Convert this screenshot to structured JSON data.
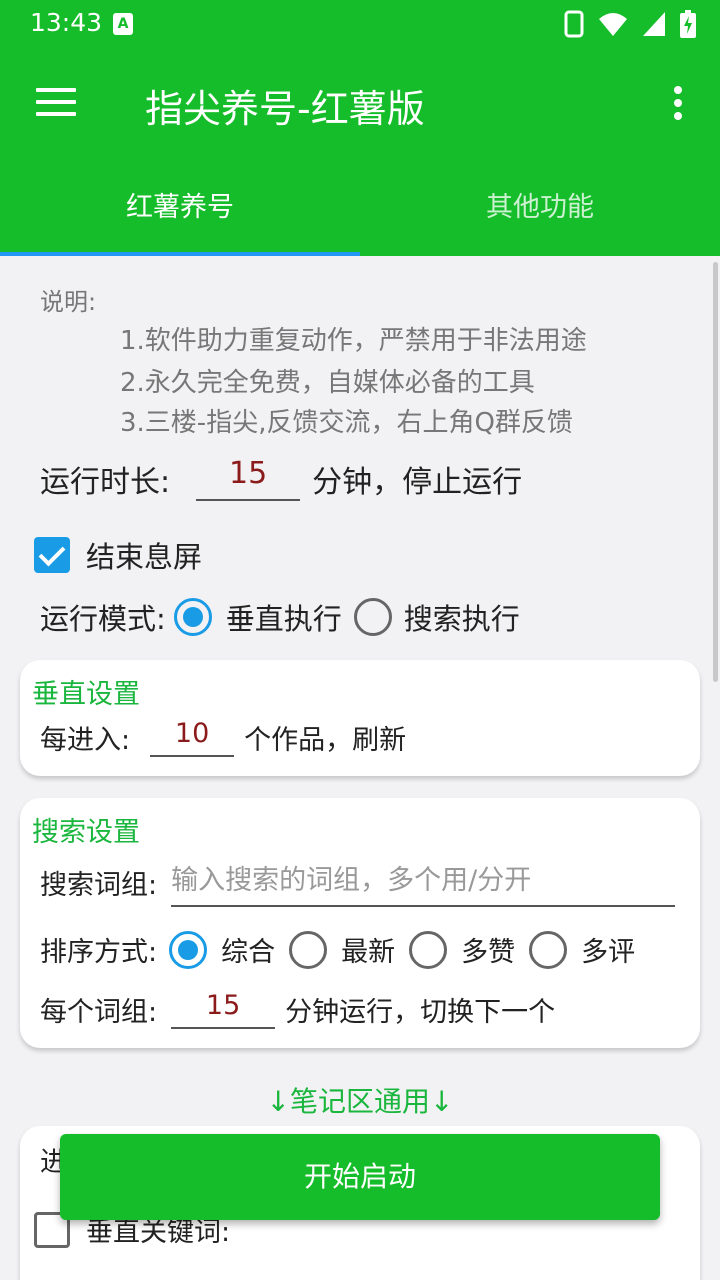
{
  "status_bar": {
    "time": "13:43",
    "notification_icon": "A"
  },
  "app_bar": {
    "title": "指尖养号-红薯版"
  },
  "tabs": [
    {
      "label": "红薯养号",
      "active": true
    },
    {
      "label": "其他功能",
      "active": false
    }
  ],
  "description": {
    "heading": "说明:",
    "lines": [
      "1.软件助力重复动作，严禁用于非法用途",
      "2.永久完全免费，自媒体必备的工具",
      "3.三楼-指尖,反馈交流，右上角Q群反馈"
    ]
  },
  "run_duration": {
    "label": "运行时长:",
    "value": "15",
    "suffix": "分钟，停止运行"
  },
  "screen_off": {
    "label": "结束息屏",
    "checked": true
  },
  "run_mode": {
    "label": "运行模式:",
    "options": [
      {
        "label": "垂直执行",
        "selected": true
      },
      {
        "label": "搜索执行",
        "selected": false
      }
    ]
  },
  "vertical_settings": {
    "title": "垂直设置",
    "label": "每进入:",
    "value": "10",
    "suffix": "个作品，刷新"
  },
  "search_settings": {
    "title": "搜索设置",
    "keyword_label": "搜索词组:",
    "keyword_placeholder": "输入搜索的词组，多个用/分开",
    "sort_label": "排序方式:",
    "sort_options": [
      {
        "label": "综合",
        "selected": true
      },
      {
        "label": "最新",
        "selected": false
      },
      {
        "label": "多赞",
        "selected": false
      },
      {
        "label": "多评",
        "selected": false
      }
    ],
    "per_group_label": "每个词组:",
    "per_group_value": "15",
    "per_group_suffix": "分钟运行，切换下一个"
  },
  "notes_section": {
    "label": "↓笔记区通用↓",
    "partial_label": "进",
    "vertical_keyword": {
      "label": "垂直关键词:",
      "checked": false
    }
  },
  "start_button": {
    "label": "开始启动"
  },
  "colors": {
    "primary": "#15bd2a",
    "accent": "#1a9be6",
    "section_title": "#1ab63d",
    "input_value": "#8b1a1a"
  }
}
